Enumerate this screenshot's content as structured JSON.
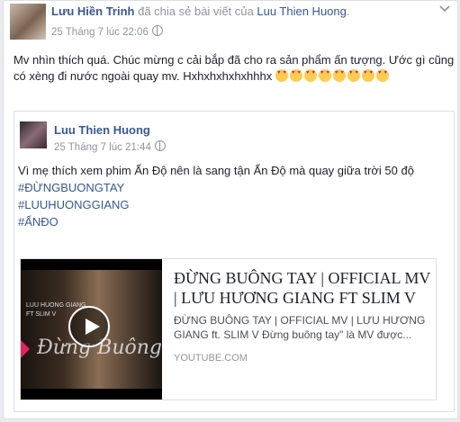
{
  "post": {
    "author": "Lưu Hiền Trinh",
    "action": "đã chia sẻ bài viết của",
    "shared_from": "Luu Thien Huong",
    "timestamp": "25 Tháng 7 lúc 22:06",
    "text": "Mv nhìn thích quá. Chúc mừng c cải bắp đã cho ra sản phẩm ấn tượng. Ước gì cũng có xèng đi nước ngoài quay mv. Hxhxhxhxhxhhhx",
    "emoji_count": 8
  },
  "shared": {
    "author": "Luu Thien Huong",
    "timestamp": "25 Tháng 7 lúc 21:44",
    "text": "Vì mẹ thích xem phim Ấn Độ nên là sang tận Ấn Độ mà quay giữa trời 50 độ",
    "hashtags": [
      "#ĐỪNGBUONGTAY",
      "#LUUHUONGGIANG",
      "#ẤNĐO"
    ]
  },
  "link_card": {
    "title": "ĐỪNG BUÔNG TAY | OFFICIAL MV | LƯU HƯƠNG GIANG FT SLIM V",
    "description": "ĐỪNG BUÔNG TAY | OFFICIAL MV | LƯU HƯƠNG GIANG ft. SLIM V Đừng buông tay\" là MV được...",
    "source": "YOUTUBE.COM",
    "thumb_title": "Đừng Buông Tay",
    "thumb_artist": "LUU HUONG GIANG",
    "thumb_feat": "FT SLIM V"
  },
  "icons": {
    "audience": "globe-icon",
    "menu": "chevron-down-icon",
    "play": "play-icon",
    "emoji": "heart-eyes-emoji-icon"
  },
  "colors": {
    "link": "#365899",
    "meta": "#90949c",
    "text": "#1d2129"
  }
}
